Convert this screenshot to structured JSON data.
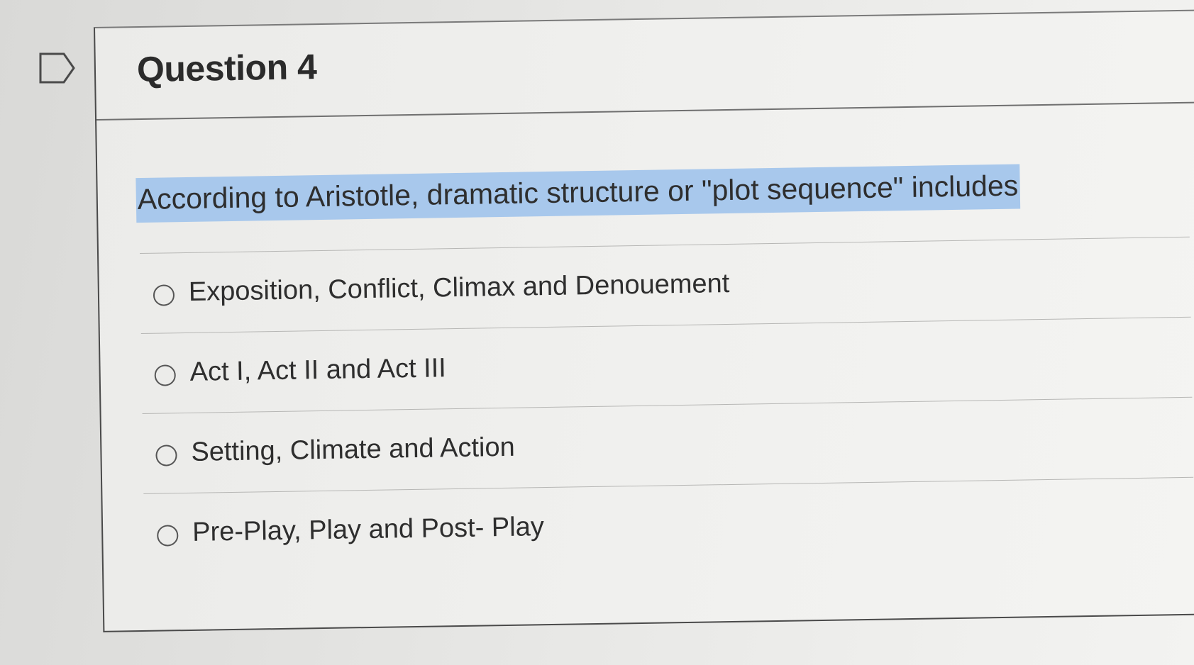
{
  "question": {
    "title": "Question 4",
    "text": "According to Aristotle, dramatic structure or \"plot sequence\" includes",
    "highlight_color": "#a8c8ec"
  },
  "flag": {
    "icon": "flag-icon"
  },
  "answers": [
    {
      "label": "Exposition, Conflict, Climax and Denouement"
    },
    {
      "label": "Act I, Act II and Act III"
    },
    {
      "label": "Setting, Climate and Action"
    },
    {
      "label": "Pre-Play, Play and Post- Play"
    }
  ]
}
